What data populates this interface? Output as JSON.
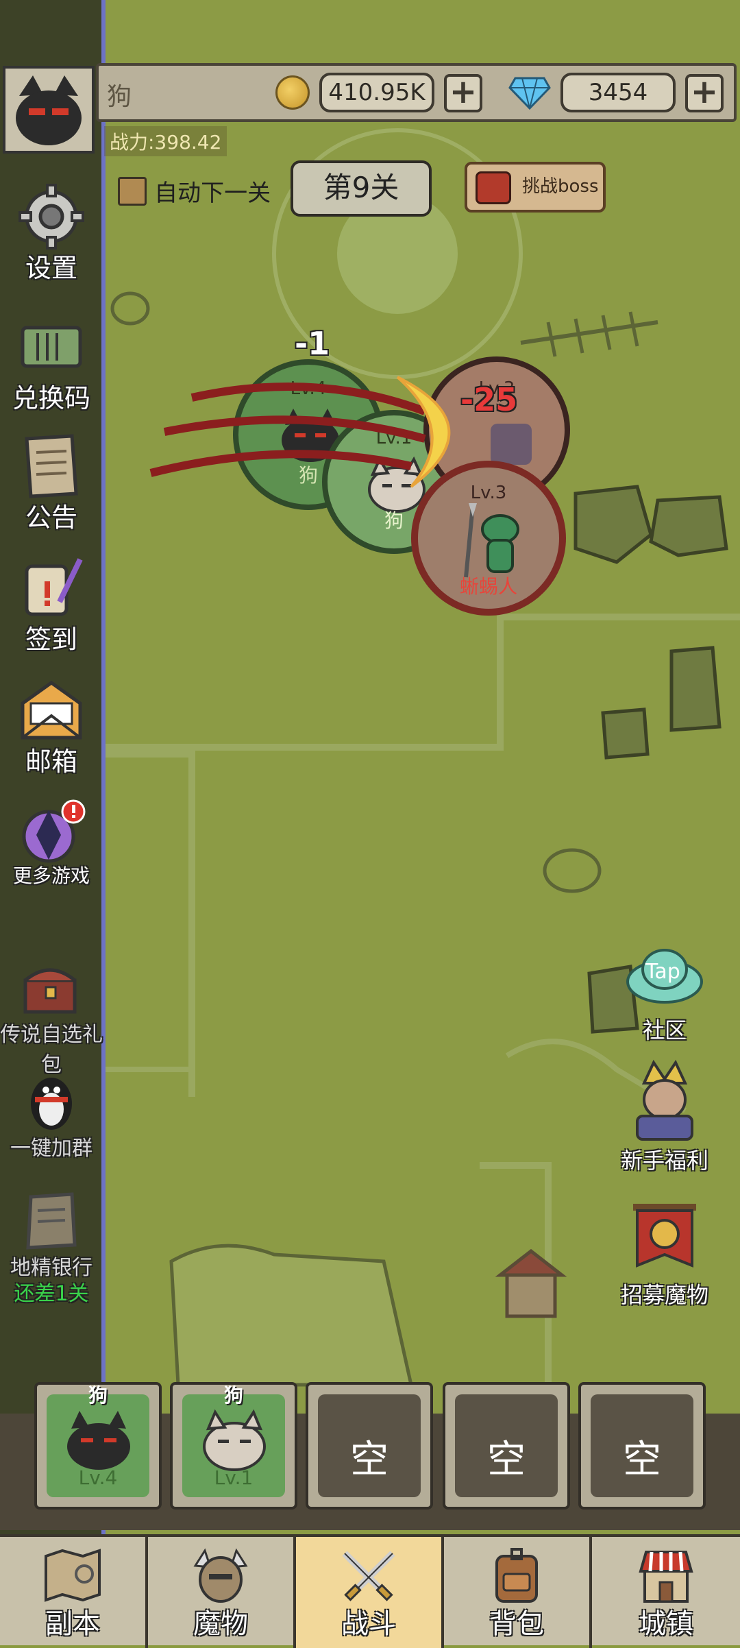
{
  "topbar": {
    "player_name": "狗",
    "gold": "410.95K",
    "gems": "3454",
    "gold_plus": "+",
    "gem_plus": "+"
  },
  "power": "战力:398.42",
  "controls": {
    "auto_next_label": "自动下一关",
    "level_label": "第9关",
    "boss_label": "挑战boss"
  },
  "sidebar": {
    "items": [
      {
        "label": "设置",
        "icon": "gear-icon"
      },
      {
        "label": "兑换码",
        "icon": "ticket-icon"
      },
      {
        "label": "公告",
        "icon": "notice-paper-icon"
      },
      {
        "label": "签到",
        "icon": "scroll-quill-icon"
      },
      {
        "label": "邮箱",
        "icon": "envelope-icon"
      },
      {
        "label": "更多游戏",
        "icon": "more-games-icon"
      },
      {
        "label": "传说自选礼包",
        "icon": "treasure-chest-icon"
      },
      {
        "label": "一键加群",
        "icon": "qq-penguin-icon"
      },
      {
        "label": "地精银行",
        "icon": "bank-icon"
      }
    ],
    "bank_sub": "还差1关"
  },
  "battle": {
    "units": [
      {
        "level": "Lv.4",
        "name": "狗",
        "side": "ally"
      },
      {
        "level": "Lv.1",
        "name": "狗",
        "side": "ally"
      },
      {
        "level": "Lv.3",
        "name": "",
        "side": "enemy"
      },
      {
        "level": "Lv.3",
        "name": "蜥蜴人",
        "side": "enemy"
      }
    ],
    "damage_ally": "-1",
    "damage_enemy": "-25",
    "dash": "-"
  },
  "right": {
    "items": [
      {
        "label": "社区",
        "icon": "tap-cloud-icon",
        "icon_text": "Tap"
      },
      {
        "label": "新手福利",
        "icon": "knight-icon"
      },
      {
        "label": "招募魔物",
        "icon": "banner-helmet-icon"
      }
    ]
  },
  "team": {
    "slots": [
      {
        "name": "狗",
        "level": "Lv.4",
        "filled": true
      },
      {
        "name": "狗",
        "level": "Lv.1",
        "filled": true
      },
      {
        "empty_label": "空",
        "filled": false
      },
      {
        "empty_label": "空",
        "filled": false
      },
      {
        "empty_label": "空",
        "filled": false
      }
    ]
  },
  "nav": {
    "tabs": [
      {
        "label": "副本",
        "icon": "map-icon"
      },
      {
        "label": "魔物",
        "icon": "monster-helmet-icon"
      },
      {
        "label": "战斗",
        "icon": "crossed-swords-icon",
        "active": true
      },
      {
        "label": "背包",
        "icon": "backpack-icon"
      },
      {
        "label": "城镇",
        "icon": "shop-icon"
      }
    ]
  }
}
